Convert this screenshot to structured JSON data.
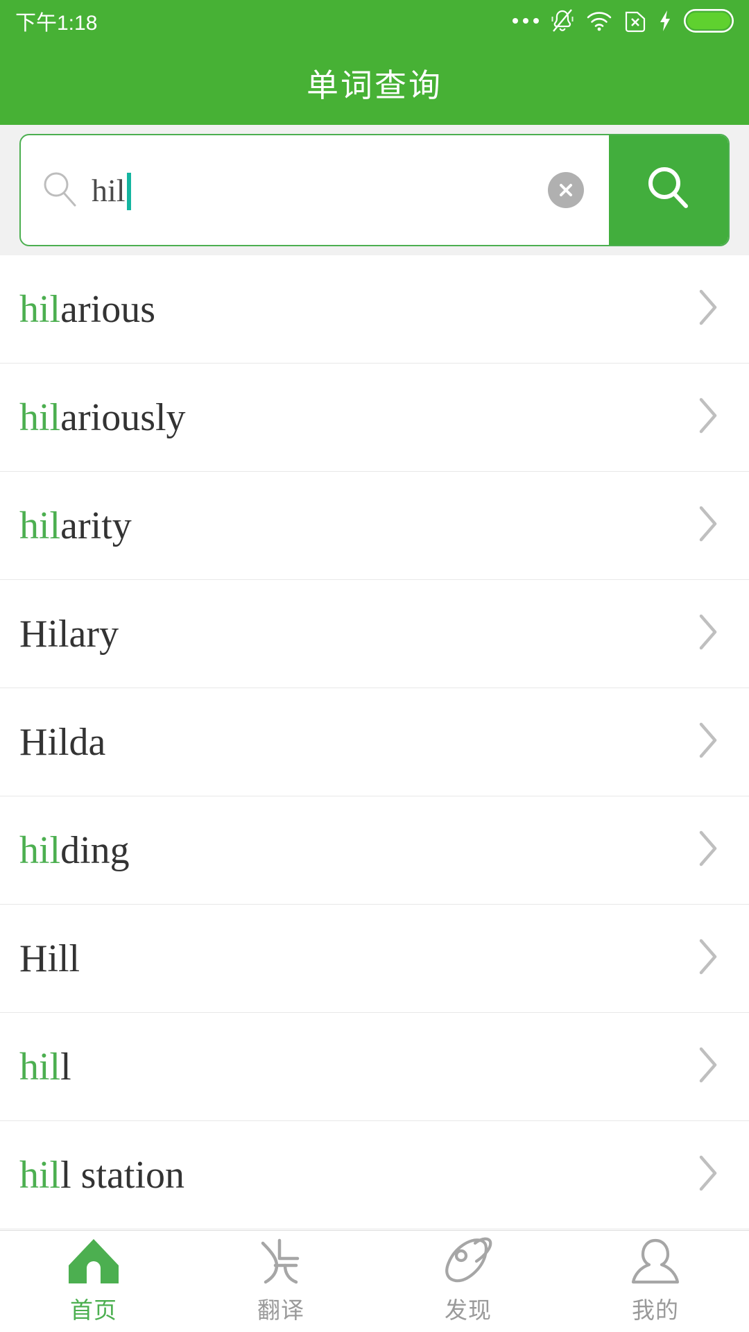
{
  "theme": {
    "brand_green": "#47b135",
    "accent_green": "#4caf50",
    "highlight_green": "#4caf50",
    "text_dark": "#333333",
    "muted_gray": "#9a9a9a",
    "caret_teal": "#14b5a0",
    "search_bg": "#f1f1f1"
  },
  "status_bar": {
    "time": "下午1:18",
    "icons": [
      "more-dots-icon",
      "silent-bell-icon",
      "wifi-icon",
      "sim-x-icon",
      "charging-bolt-icon",
      "battery-icon"
    ]
  },
  "header": {
    "title": "单词查询"
  },
  "search": {
    "icon": "search-icon",
    "value": "hil",
    "placeholder": "",
    "clear_icon": "clear-circle-icon",
    "submit_icon": "search-icon"
  },
  "results": [
    {
      "text": "hilarious",
      "match": "hil",
      "rest": "arious",
      "chevron": "chevron-right-icon"
    },
    {
      "text": "hilariously",
      "match": "hil",
      "rest": "ariously",
      "chevron": "chevron-right-icon"
    },
    {
      "text": "hilarity",
      "match": "hil",
      "rest": "arity",
      "chevron": "chevron-right-icon"
    },
    {
      "text": "Hilary",
      "match": "",
      "rest": "Hilary",
      "chevron": "chevron-right-icon"
    },
    {
      "text": "Hilda",
      "match": "",
      "rest": "Hilda",
      "chevron": "chevron-right-icon"
    },
    {
      "text": "hilding",
      "match": "hil",
      "rest": "ding",
      "chevron": "chevron-right-icon"
    },
    {
      "text": "Hill",
      "match": "",
      "rest": "Hill",
      "chevron": "chevron-right-icon"
    },
    {
      "text": "hill",
      "match": "hil",
      "rest": "l",
      "chevron": "chevron-right-icon"
    },
    {
      "text": "hill station",
      "match": "hil",
      "rest": "l station",
      "chevron": "chevron-right-icon"
    }
  ],
  "tabbar": {
    "items": [
      {
        "label": "首页",
        "icon": "home-icon",
        "active": true
      },
      {
        "label": "翻译",
        "icon": "translate-icon",
        "active": false
      },
      {
        "label": "发现",
        "icon": "discover-rocket-icon",
        "active": false
      },
      {
        "label": "我的",
        "icon": "person-icon",
        "active": false
      }
    ]
  }
}
